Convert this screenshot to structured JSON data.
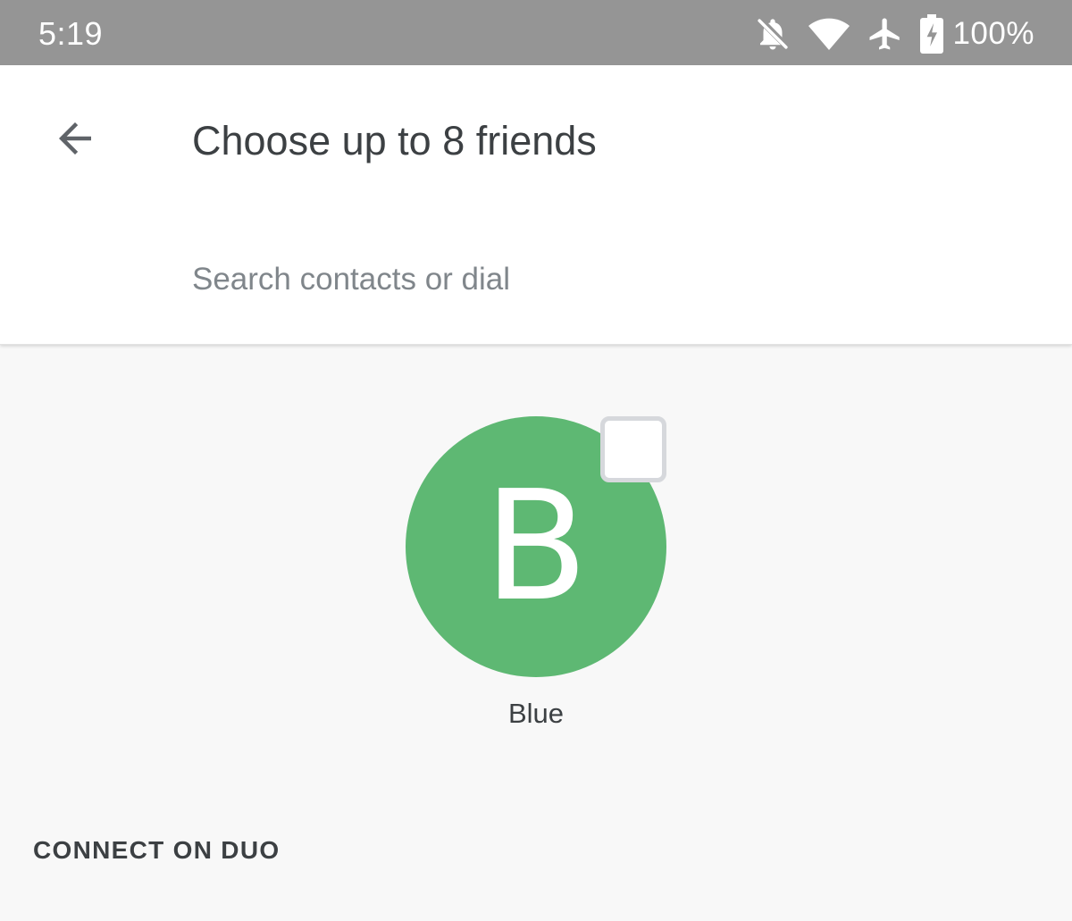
{
  "status_bar": {
    "time": "5:19",
    "battery_percent": "100%",
    "icons": [
      "notifications-off-icon",
      "wifi-icon",
      "airplane-mode-icon",
      "battery-charging-icon"
    ]
  },
  "header": {
    "back_icon": "arrow-back-icon",
    "title": "Choose up to 8 friends",
    "search_placeholder": "Search contacts or dial",
    "search_value": ""
  },
  "contacts": [
    {
      "initial": "B",
      "name": "Blue",
      "avatar_color": "#5eb873",
      "selected": false
    }
  ],
  "sections": {
    "connect_on_duo": "CONNECT ON DUO"
  },
  "colors": {
    "status_bar": "#959595",
    "header_bg": "#ffffff",
    "body_bg": "#f8f8f8",
    "text_primary": "#3c4043",
    "placeholder": "#80868b"
  }
}
